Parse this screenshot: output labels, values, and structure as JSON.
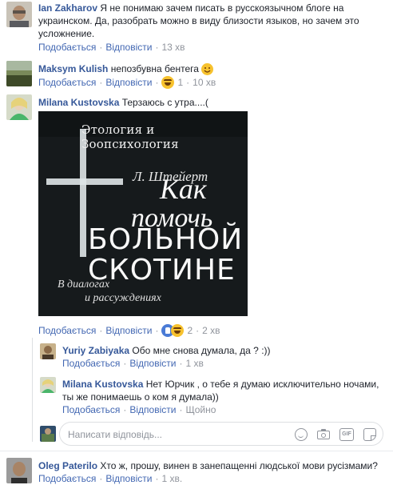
{
  "colors": {
    "link": "#4267b2",
    "author": "#365899",
    "meta": "#90949c",
    "text": "#1d2129"
  },
  "comments": [
    {
      "author": "",
      "text": "Я не понимаю зачем писать в русскоязычном блоге на украинском. Да, разобрать можно в виду близости языков, но зачем это усложнение.",
      "like": "Подобається",
      "reply": "Відповісти",
      "time": "13 хв"
    },
    {
      "author": "Maksym Kulish",
      "text": "непозбувна бентега",
      "emoji": "smile-emoji",
      "like": "Подобається",
      "reply": "Відповісти",
      "reaction_count": "1",
      "time": "10 хв"
    },
    {
      "author": "Milana Kustovska",
      "text": "Терзаюсь с утра....(",
      "like": "Подобається",
      "reply": "Відповісти",
      "reaction_count": "2",
      "time": "2 хв"
    }
  ],
  "first_author": "Ian Zakharov",
  "book": {
    "series": "Этология и Зоопсихология",
    "author": "Л. Штейерт",
    "title_line1": "Как",
    "title_line2": "помочь",
    "title_line3": "БОЛЬНОЙ",
    "title_line4": "СКОТИНЕ",
    "subtitle_line1": "В диалогах",
    "subtitle_line2": "и рассуждениях"
  },
  "replies": [
    {
      "author": "Yuriy Zabiyaka",
      "text": "Обо мне снова думала, да ? :))",
      "like": "Подобається",
      "reply": "Відповісти",
      "time": "1 хв"
    },
    {
      "author": "Milana Kustovska",
      "text": "Нет Юрчик , о тебе я думаю исключительно ночами, ты же понимаешь о ком я думала))",
      "like": "Подобається",
      "reply": "Відповісти",
      "time": "Щойно"
    }
  ],
  "reply_input": {
    "placeholder": "Написати відповідь...",
    "gif_label": "GIF"
  },
  "last_comment": {
    "author": "Oleg Paterilo",
    "text": "Хто ж, прошу, винен в занепащенні людської мови русізмами?",
    "like": "Подобається",
    "reply": "Відповісти",
    "time": "1 хв."
  }
}
